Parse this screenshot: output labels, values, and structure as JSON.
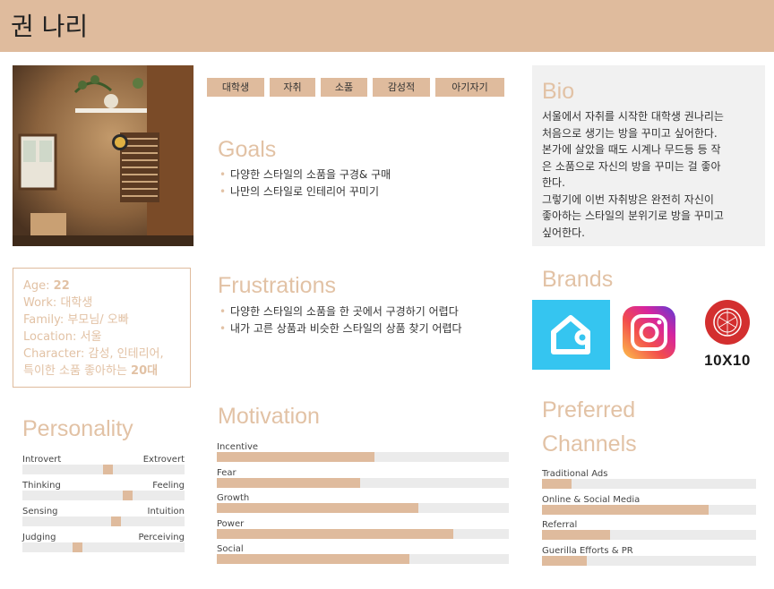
{
  "header": {
    "name": "권 나리"
  },
  "photo": {
    "description_icon": "room-photo"
  },
  "tags": [
    "대학생",
    "자취",
    "소품",
    "감성적",
    "아기자기"
  ],
  "bio": {
    "title": "Bio",
    "lines": [
      "서울에서 자취를 시작한 대학생 권나리는",
      "처음으로 생기는 방을 꾸미고 싶어한다.",
      "본가에 살았을 때도 시계나 무드등 등 작",
      "은 소품으로 자신의 방을 꾸미는 걸 좋아",
      "한다.",
      "그렇기에 이번 자취방은 완전히 자신이",
      "좋아하는 스타일의 분위기로 방을 꾸미고",
      "싶어한다."
    ]
  },
  "goals": {
    "title": "Goals",
    "items": [
      "다양한 스타일의 소품을 구경& 구매",
      "나만의 스타일로 인테리어 꾸미기"
    ]
  },
  "frustrations": {
    "title": "Frustrations",
    "items": [
      "다양한 스타일의 소품을 한 곳에서 구경하기 어렵다",
      "내가 고른 상품과 비슷한 스타일의 상품 찾기 어렵다"
    ]
  },
  "info": {
    "age_label": "Age:",
    "age": "22",
    "work_label": "Work:",
    "work": "대학생",
    "family_label": "Family:",
    "family": "부모님/ 오빠",
    "location_label": "Location:",
    "location": "서울",
    "character_label": "Character:",
    "character_1": "감성, 인테리어,",
    "character_2a": "특이한 소품 좋아하는 ",
    "character_2b": "20대"
  },
  "brands": {
    "title": "Brands",
    "logos": [
      {
        "name": "house-app-logo",
        "color": "#35c5f0"
      },
      {
        "name": "instagram-logo",
        "color": "#d6249f"
      },
      {
        "name": "10x10-logo",
        "text": "10X10",
        "color": "#d32f2f"
      }
    ]
  },
  "personality": {
    "title": "Personality",
    "traits": [
      {
        "left": "Introvert",
        "right": "Extrovert",
        "value": 0.53
      },
      {
        "left": "Thinking",
        "right": "Feeling",
        "value": 0.66
      },
      {
        "left": "Sensing",
        "right": "Intuition",
        "value": 0.58
      },
      {
        "left": "Judging",
        "right": "Perceiving",
        "value": 0.33
      }
    ]
  },
  "motivation": {
    "title": "Motivation",
    "bars": [
      {
        "label": "Incentive",
        "value": 0.54
      },
      {
        "label": "Fear",
        "value": 0.49
      },
      {
        "label": "Growth",
        "value": 0.69
      },
      {
        "label": "Power",
        "value": 0.81
      },
      {
        "label": "Social",
        "value": 0.66
      }
    ]
  },
  "channels": {
    "title_1": "Preferred",
    "title_2": "Channels",
    "bars": [
      {
        "label": "Traditional Ads",
        "value": 0.14
      },
      {
        "label": "Online & Social Media",
        "value": 0.78
      },
      {
        "label": "Referral",
        "value": 0.32
      },
      {
        "label": "Guerilla Efforts & PR",
        "value": 0.21
      }
    ]
  },
  "colors": {
    "accent": "#dfbb9d",
    "heading": "#e2c2a5",
    "track": "#ebebeb"
  }
}
